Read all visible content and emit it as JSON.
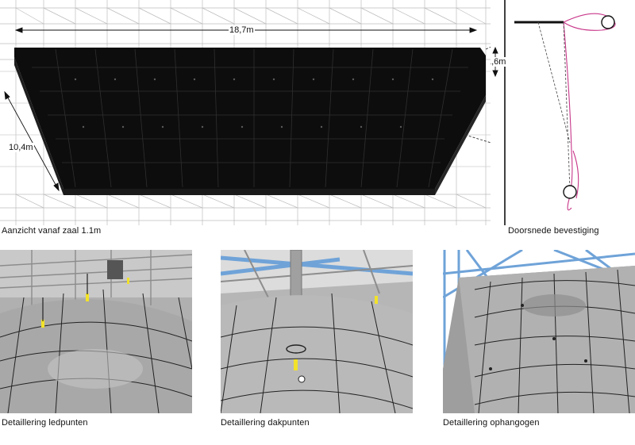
{
  "main_view": {
    "width_label": "18,7m",
    "depth_label": "10,4m",
    "caption": "Aanzicht vanaf zaal 1.1m"
  },
  "section": {
    "height_label": "1,6m",
    "caption": "Doorsnede bevestiging"
  },
  "details": [
    {
      "caption": "Detaillering ledpunten"
    },
    {
      "caption": "Detaillering dakpunten"
    },
    {
      "caption": "Detaillering ophangogen"
    }
  ],
  "colors": {
    "canopy": "#0d0d0d",
    "scaffold": "#9a9a9a",
    "blue_truss": "#6fa3d8",
    "membrane": "#b4b4b4",
    "magenta": "#c8378a",
    "marker": "#f2e22a"
  }
}
